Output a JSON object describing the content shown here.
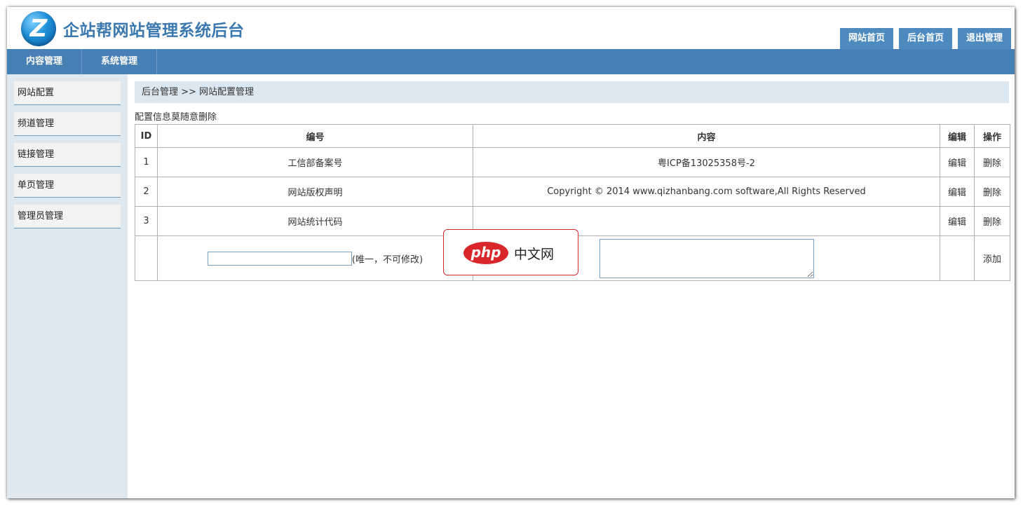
{
  "header": {
    "logo_letter": "Z",
    "title": "企站帮网站管理系统后台",
    "links": [
      "网站首页",
      "后台首页",
      "退出管理"
    ]
  },
  "nav": [
    "内容管理",
    "系统管理"
  ],
  "sidebar": [
    "网站配置",
    "频道管理",
    "链接管理",
    "单页管理",
    "管理员管理"
  ],
  "main": {
    "breadcrumb": "后台管理 >> 网站配置管理",
    "note": "配置信息莫随意删除",
    "table": {
      "headers": [
        "ID",
        "编号",
        "内容",
        "编辑",
        "操作"
      ],
      "rows": [
        {
          "id": "1",
          "code": "工信部备案号",
          "content": "粤ICP备13025358号-2",
          "edit": "编辑",
          "op": "删除"
        },
        {
          "id": "2",
          "code": "网站版权声明",
          "content": "Copyright © 2014 www.qizhanbang.com software,All Rights Reserved",
          "edit": "编辑",
          "op": "删除"
        },
        {
          "id": "3",
          "code": "网站统计代码",
          "content": "",
          "edit": "编辑",
          "op": "删除"
        }
      ],
      "add_row": {
        "code_value": "",
        "hint": "(唯一，不可修改)",
        "content_value": "",
        "op": "添加"
      }
    }
  },
  "watermark": {
    "logo": "php",
    "text": "中文网"
  },
  "colors": {
    "nav_bg": "#4680b5",
    "title": "#3a78b0",
    "sidebar_bg": "#dde8f1",
    "watermark_red": "#d9262b"
  }
}
